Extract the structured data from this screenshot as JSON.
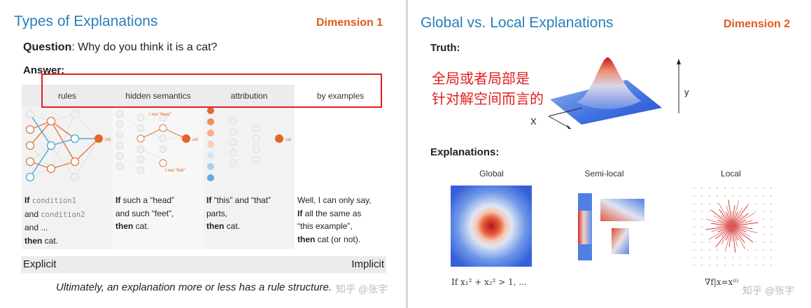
{
  "left": {
    "title": "Types of Explanations",
    "dimension": "Dimension 1",
    "question_label": "Question",
    "question_text": ": Why do you think it is a cat?",
    "answer_label": "Answer:",
    "columns": [
      {
        "header": "rules",
        "lines": [
          [
            "If ",
            "condition1"
          ],
          [
            "and ",
            "condition2"
          ],
          [
            "and ..."
          ],
          [
            "then ",
            "cat."
          ]
        ]
      },
      {
        "header": "hidden semantics",
        "lines": [
          [
            "If ",
            "such a “head”"
          ],
          [
            "and such “feet”,"
          ],
          [
            "then ",
            "cat."
          ]
        ]
      },
      {
        "header": "attribution",
        "lines": [
          [
            "If ",
            "“this” and “that”"
          ],
          [
            "parts,"
          ],
          [
            "then ",
            "cat."
          ]
        ]
      },
      {
        "header": "by examples",
        "lines": [
          [
            "Well, I can only say,"
          ],
          [
            "If ",
            "all the same as"
          ],
          [
            "“this example”,"
          ],
          [
            "then ",
            "cat (or not)."
          ]
        ]
      }
    ],
    "net_labels": {
      "cat": "cat",
      "head": "I see “head”",
      "feet": "I see “feet”"
    },
    "explicit": "Explicit",
    "implicit": "Implicit",
    "footer": "Ultimately, an explanation more or less has a rule structure.",
    "watermark": "知乎 @张宇"
  },
  "right": {
    "title": "Global vs. Local Explanations",
    "dimension": "Dimension 2",
    "truth_label": "Truth:",
    "annotation_line1": "全局或者局部是",
    "annotation_line2": "针对解空间而言的",
    "axis_x": "X",
    "axis_y": "y",
    "explanations_label": "Explanations:",
    "panels": [
      "Global",
      "Semi-local",
      "Local"
    ],
    "global_formula": "If x₁² + x₂² > 1, ...",
    "local_formula": "∇f|x=x⁽ⁱ⁾",
    "watermark": "知乎 @张宇"
  }
}
